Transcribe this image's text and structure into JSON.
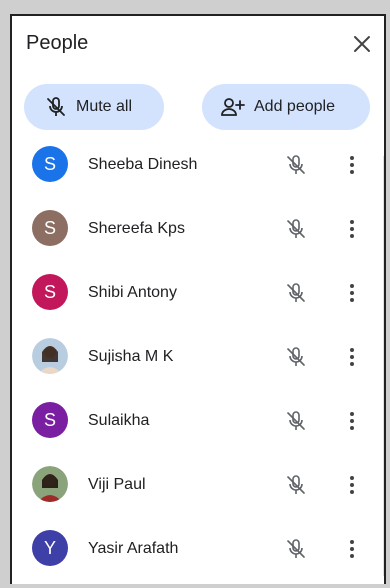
{
  "panel": {
    "title": "People"
  },
  "actions": {
    "mute_all": "Mute all",
    "add_people": "Add people"
  },
  "icons": {
    "close": "close-icon",
    "mic_off": "mic-off-icon",
    "more": "more-vert-icon",
    "add_person": "person-add-icon"
  },
  "people": [
    {
      "initial": "S",
      "name": "Sheeba Dinesh",
      "avatar_color": "#1a73e8",
      "photo": false
    },
    {
      "initial": "S",
      "name": "Shereefa Kps",
      "avatar_color": "#8d6e63",
      "photo": false
    },
    {
      "initial": "S",
      "name": "Shibi Antony",
      "avatar_color": "#c2185b",
      "photo": false
    },
    {
      "initial": "",
      "name": "Sujisha M K",
      "avatar_color": "#6d8fb3",
      "photo": true
    },
    {
      "initial": "S",
      "name": "Sulaikha",
      "avatar_color": "#7b1fa2",
      "photo": false
    },
    {
      "initial": "",
      "name": "Viji Paul",
      "avatar_color": "#5c7a4a",
      "photo": true
    },
    {
      "initial": "Y",
      "name": "Yasir Arafath",
      "avatar_color": "#3f3fa8",
      "photo": false
    }
  ]
}
